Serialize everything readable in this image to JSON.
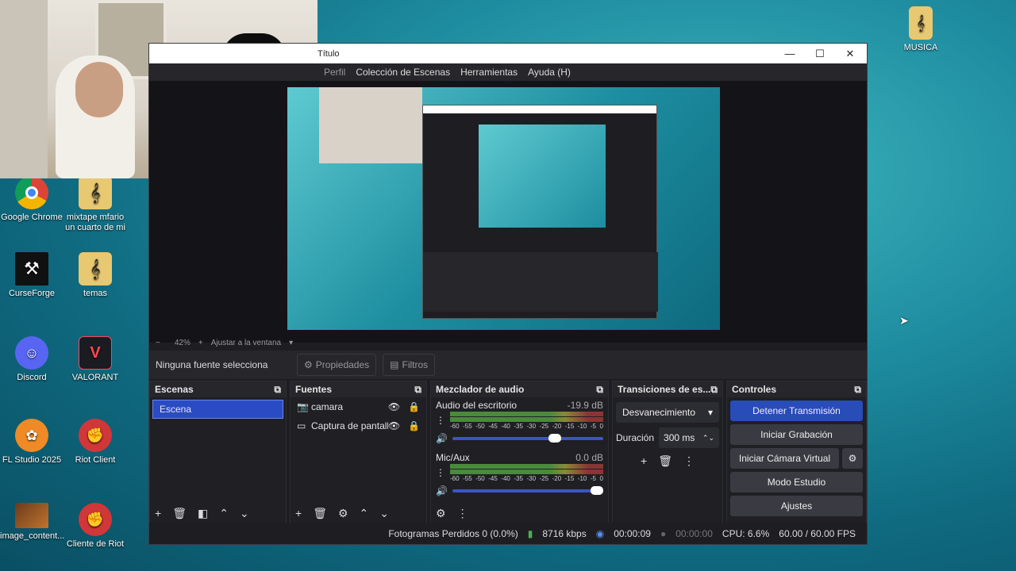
{
  "desktop": {
    "icons": [
      {
        "label": "Google Chrome"
      },
      {
        "label": "mixtape mfario un cuarto de mi"
      },
      {
        "label": "CurseForge"
      },
      {
        "label": "temas"
      },
      {
        "label": "Discord"
      },
      {
        "label": "VALORANT"
      },
      {
        "label": "FL Studio 2025"
      },
      {
        "label": "Riot Client"
      },
      {
        "label": "image_content..."
      },
      {
        "label": "Cliente de Riot"
      },
      {
        "label": "MUSICA"
      }
    ]
  },
  "obs": {
    "title": "Título",
    "menu": [
      "Perfil",
      "Colección de Escenas",
      "Herramientas",
      "Ayuda (H)"
    ],
    "zoom": {
      "minus": "−",
      "percent": "42%",
      "plus": "+",
      "fit": "Ajustar a la ventana"
    },
    "source_bar": {
      "no_source": "Ninguna fuente selecciona",
      "properties": "Propiedades",
      "filters": "Filtros"
    },
    "scenes": {
      "title": "Escenas",
      "items": [
        "Escena"
      ]
    },
    "sources": {
      "title": "Fuentes",
      "items": [
        "camara",
        "Captura de pantalla"
      ]
    },
    "mixer": {
      "title": "Mezclador de audio",
      "channels": [
        {
          "name": "Audio del escritorio",
          "db": "-19.9 dB",
          "volume": 0.72
        },
        {
          "name": "Mic/Aux",
          "db": "0.0 dB",
          "volume": 1.0
        }
      ],
      "ticks": [
        "-60",
        "-55",
        "-50",
        "-45",
        "-40",
        "-35",
        "-30",
        "-25",
        "-20",
        "-15",
        "-10",
        "-5",
        "0"
      ]
    },
    "transitions": {
      "title": "Transiciones de es...",
      "selected": "Desvanecimiento",
      "duration_label": "Duración",
      "duration": "300 ms"
    },
    "controls": {
      "title": "Controles",
      "buttons": [
        "Detener Transmisión",
        "Iniciar Grabación",
        "Iniciar Cámara Virtual",
        "Modo Estudio",
        "Ajustes"
      ]
    },
    "status": {
      "dropped": "Fotogramas Perdidos 0 (0.0%)",
      "bitrate": "8716 kbps",
      "stream_time": "00:00:09",
      "rec_time": "00:00:00",
      "cpu": "CPU: 6.6%",
      "fps": "60.00 / 60.00 FPS"
    }
  },
  "colors": {
    "accent": "#284cb8",
    "desktop": "#1f8ea1"
  }
}
